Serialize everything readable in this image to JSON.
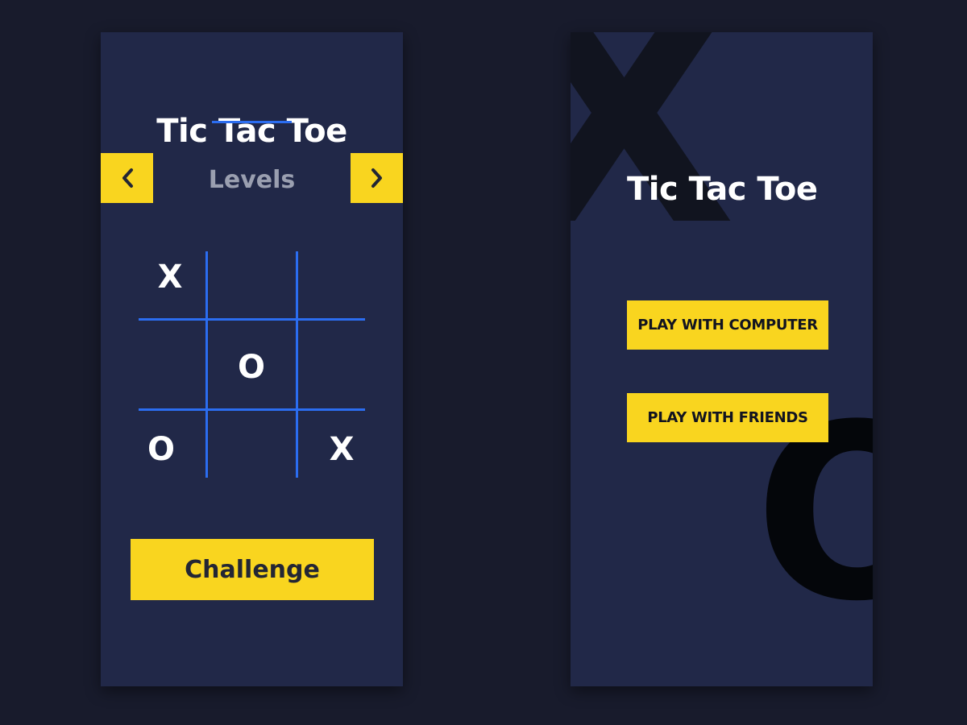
{
  "left_screen": {
    "title": "Tic Tac Toe",
    "levels_label": "Levels",
    "prev_icon": "chevron-left-icon",
    "next_icon": "chevron-right-icon",
    "board": [
      "X",
      "",
      "",
      "",
      "O",
      "",
      "O",
      "",
      "X"
    ],
    "challenge_label": "Challenge"
  },
  "right_screen": {
    "title": "Tic Tac Toe",
    "bg_x": "X",
    "bg_o": "O",
    "play_computer_label": "PLAY WITH COMPUTER",
    "play_friends_label": "PLAY WITH FRIENDS"
  },
  "colors": {
    "background": "#181b2c",
    "screen": "#212848",
    "accent_yellow": "#f9d51f",
    "grid_blue": "#2b6df0"
  }
}
